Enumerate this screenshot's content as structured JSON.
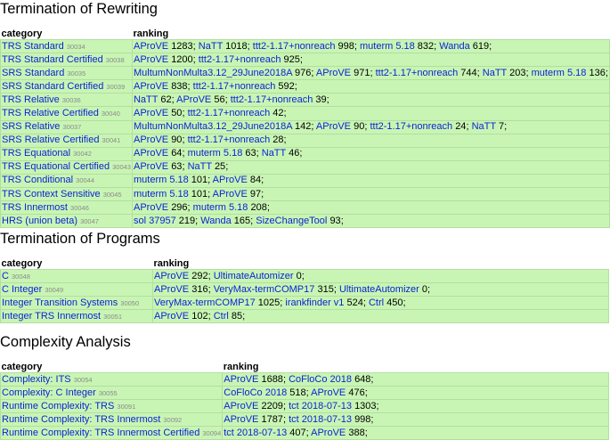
{
  "sections": [
    {
      "title": "Termination of Rewriting",
      "headers": {
        "category": "category",
        "ranking": "ranking"
      },
      "rows": [
        {
          "category": "TRS Standard",
          "id": "30034",
          "ranking": [
            [
              "AProVE",
              "1283"
            ],
            [
              "NaTT",
              "1018"
            ],
            [
              "ttt2-1.17+nonreach",
              "998"
            ],
            [
              "muterm 5.18",
              "832"
            ],
            [
              "Wanda",
              "619"
            ]
          ]
        },
        {
          "category": "TRS Standard Certified",
          "id": "30038",
          "ranking": [
            [
              "AProVE",
              "1200"
            ],
            [
              "ttt2-1.17+nonreach",
              "925"
            ]
          ]
        },
        {
          "category": "SRS Standard",
          "id": "30035",
          "ranking": [
            [
              "MultumNonMulta3.12_29June2018A",
              "976"
            ],
            [
              "AProVE",
              "971"
            ],
            [
              "ttt2-1.17+nonreach",
              "744"
            ],
            [
              "NaTT",
              "203"
            ],
            [
              "muterm 5.18",
              "136"
            ]
          ]
        },
        {
          "category": "SRS Standard Certified",
          "id": "30039",
          "ranking": [
            [
              "AProVE",
              "838"
            ],
            [
              "ttt2-1.17+nonreach",
              "592"
            ]
          ]
        },
        {
          "category": "TRS Relative",
          "id": "30036",
          "ranking": [
            [
              "NaTT",
              "62"
            ],
            [
              "AProVE",
              "56"
            ],
            [
              "ttt2-1.17+nonreach",
              "39"
            ]
          ]
        },
        {
          "category": "TRS Relative Certified",
          "id": "30040",
          "ranking": [
            [
              "AProVE",
              "50"
            ],
            [
              "ttt2-1.17+nonreach",
              "42"
            ]
          ]
        },
        {
          "category": "SRS Relative",
          "id": "30037",
          "ranking": [
            [
              "MultumNonMulta3.12_29June2018A",
              "142"
            ],
            [
              "AProVE",
              "90"
            ],
            [
              "ttt2-1.17+nonreach",
              "24"
            ],
            [
              "NaTT",
              "7"
            ]
          ]
        },
        {
          "category": "SRS Relative Certified",
          "id": "30041",
          "ranking": [
            [
              "AProVE",
              "90"
            ],
            [
              "ttt2-1.17+nonreach",
              "28"
            ]
          ]
        },
        {
          "category": "TRS Equational",
          "id": "30042",
          "ranking": [
            [
              "AProVE",
              "64"
            ],
            [
              "muterm 5.18",
              "63"
            ],
            [
              "NaTT",
              "46"
            ]
          ]
        },
        {
          "category": "TRS Equational Certified",
          "id": "30043",
          "ranking": [
            [
              "AProVE",
              "63"
            ],
            [
              "NaTT",
              "25"
            ]
          ]
        },
        {
          "category": "TRS Conditional",
          "id": "30044",
          "ranking": [
            [
              "muterm 5.18",
              "101"
            ],
            [
              "AProVE",
              "84"
            ]
          ]
        },
        {
          "category": "TRS Context Sensitive",
          "id": "30045",
          "ranking": [
            [
              "muterm 5.18",
              "101"
            ],
            [
              "AProVE",
              "97"
            ]
          ]
        },
        {
          "category": "TRS Innermost",
          "id": "30046",
          "ranking": [
            [
              "AProVE",
              "296"
            ],
            [
              "muterm 5.18",
              "208"
            ]
          ]
        },
        {
          "category": "HRS (union beta)",
          "id": "30047",
          "ranking": [
            [
              "sol 37957",
              "219"
            ],
            [
              "Wanda",
              "165"
            ],
            [
              "SizeChangeTool",
              "93"
            ]
          ]
        }
      ]
    },
    {
      "title": "Termination of Programs",
      "headers": {
        "category": "category",
        "ranking": "ranking"
      },
      "rows": [
        {
          "category": "C",
          "id": "30048",
          "ranking": [
            [
              "AProVE",
              "292"
            ],
            [
              "UltimateAutomizer",
              "0"
            ]
          ]
        },
        {
          "category": "C Integer",
          "id": "30049",
          "ranking": [
            [
              "AProVE",
              "316"
            ],
            [
              "VeryMax-termCOMP17",
              "315"
            ],
            [
              "UltimateAutomizer",
              "0"
            ]
          ]
        },
        {
          "category": "Integer Transition Systems",
          "id": "30050",
          "ranking": [
            [
              "VeryMax-termCOMP17",
              "1025"
            ],
            [
              "irankfinder v1",
              "524"
            ],
            [
              "Ctrl",
              "450"
            ]
          ]
        },
        {
          "category": "Integer TRS Innermost",
          "id": "30051",
          "ranking": [
            [
              "AProVE",
              "102"
            ],
            [
              "Ctrl",
              "85"
            ]
          ]
        }
      ]
    },
    {
      "title": "Complexity Analysis",
      "headers": {
        "category": "category",
        "ranking": "ranking"
      },
      "rows": [
        {
          "category": "Complexity: ITS",
          "id": "30054",
          "ranking": [
            [
              "AProVE",
              "1688"
            ],
            [
              "CoFloCo 2018",
              "648"
            ]
          ]
        },
        {
          "category": "Complexity: C Integer",
          "id": "30055",
          "ranking": [
            [
              "CoFloCo 2018",
              "518"
            ],
            [
              "AProVE",
              "476"
            ]
          ]
        },
        {
          "category": "Runtime Complexity: TRS",
          "id": "30091",
          "ranking": [
            [
              "AProVE",
              "2209"
            ],
            [
              "tct 2018-07-13",
              "1303"
            ]
          ]
        },
        {
          "category": "Runtime Complexity: TRS Innermost",
          "id": "30092",
          "ranking": [
            [
              "AProVE",
              "1787"
            ],
            [
              "tct 2018-07-13",
              "998"
            ]
          ]
        },
        {
          "category": "Runtime Complexity: TRS Innermost Certified",
          "id": "30094",
          "ranking": [
            [
              "tct 2018-07-13",
              "407"
            ],
            [
              "AProVE",
              "388"
            ]
          ]
        }
      ]
    }
  ]
}
